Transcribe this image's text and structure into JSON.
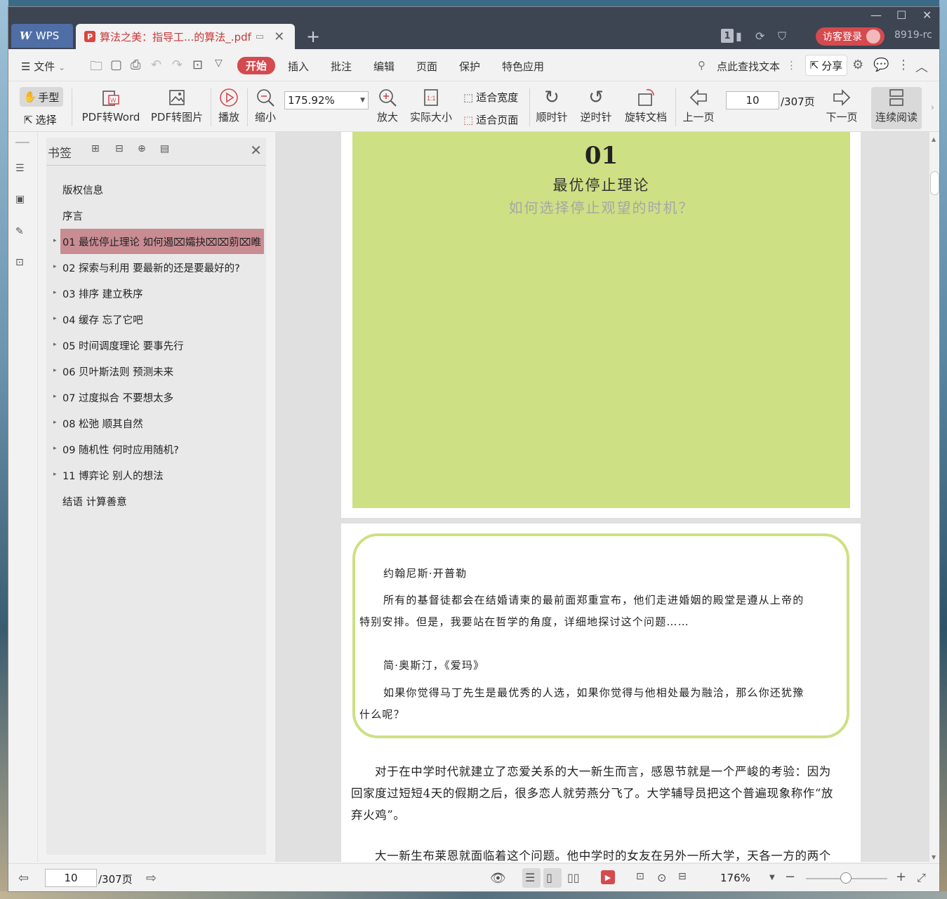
{
  "app": {
    "brand": "WPS",
    "tab_title": "算法之美：指导工...的算法_.pdf",
    "version": "8919-rc",
    "login_label": "访客登录",
    "notification_count": "1"
  },
  "menu": {
    "file_label": "文件",
    "tabs": [
      "开始",
      "插入",
      "批注",
      "编辑",
      "页面",
      "保护",
      "特色应用"
    ],
    "active_tab": "开始",
    "search_placeholder": "点此查找文本",
    "share_label": "分享"
  },
  "toolbar": {
    "hand_label": "手型",
    "select_label": "选择",
    "pdf_to_word": "PDF转Word",
    "pdf_to_image": "PDF转图片",
    "play": "播放",
    "zoom_out": "缩小",
    "zoom_value": "175.92%",
    "zoom_in": "放大",
    "actual_size": "实际大小",
    "fit_width": "适合宽度",
    "fit_page": "适合页面",
    "clockwise": "顺时针",
    "counter_clockwise": "逆时针",
    "rotate_doc": "旋转文档",
    "prev_page": "上一页",
    "page_current": "10",
    "page_total": "/307页",
    "next_page": "下一页",
    "continuous_read": "连续阅读"
  },
  "bookmarks": {
    "title": "书签",
    "items": [
      {
        "label": "版权信息",
        "expandable": false,
        "selected": false
      },
      {
        "label": "序言",
        "expandable": false,
        "selected": false
      },
      {
        "label": "01 最优停止理论 如何遏⌧孀抉⌧⌧莂⌧睢",
        "expandable": true,
        "selected": true
      },
      {
        "label": "02 探索与利用 要最新的还是要最好的?",
        "expandable": true,
        "selected": false
      },
      {
        "label": "03 排序 建立秩序",
        "expandable": true,
        "selected": false
      },
      {
        "label": "04 缓存 忘了它吧",
        "expandable": true,
        "selected": false
      },
      {
        "label": "05 时间调度理论 要事先行",
        "expandable": true,
        "selected": false
      },
      {
        "label": "06 贝叶斯法则 预测未来",
        "expandable": true,
        "selected": false
      },
      {
        "label": "07 过度拟合 不要想太多",
        "expandable": true,
        "selected": false
      },
      {
        "label": "08 松弛 顺其自然",
        "expandable": true,
        "selected": false
      },
      {
        "label": "09 随机性 何时应用随机?",
        "expandable": true,
        "selected": false
      },
      {
        "label": "11 博弈论 别人的想法",
        "expandable": true,
        "selected": false
      },
      {
        "label": "结语 计算善意",
        "expandable": false,
        "selected": false
      }
    ]
  },
  "document": {
    "chapter_number": "01",
    "chapter_title": "最优停止理论",
    "chapter_subtitle": "如何选择停止观望的时机？",
    "quote1_author": "约翰尼斯·开普勒",
    "quote1_line1": "所有的基督徒都会在结婚请柬的最前面郑重宣布，他们走进婚姻的殿堂是遵从上帝的",
    "quote1_line2": "特别安排。但是，我要站在哲学的角度，详细地探讨这个问题……",
    "quote2_author": "简·奥斯汀，《爱玛》",
    "quote2_line1": "如果你觉得马丁先生是最优秀的人选，如果你觉得与他相处最为融洽，那么你还犹豫",
    "quote2_line2": "什么呢？",
    "para1_line1": "对于在中学时代就建立了恋爱关系的大一新生而言，感恩节就是一个严峻的考验：因为",
    "para1_line2": "回家度过短短4天的假期之后，很多恋人就劳燕分飞了。大学辅导员把这个普遍现象称作“放",
    "para1_line3": "弃火鸡”。",
    "para2_line1": "大一新生布莱恩就面临着这个问题。他中学时的女友在另外一所大学，天各一方的两个"
  },
  "statusbar": {
    "page_current": "10",
    "page_total": "/307页",
    "zoom": "176%"
  },
  "colors": {
    "accent": "#d44a4e",
    "titlebar": "#3d4452",
    "chapter_green": "#cde084",
    "bookmark_selected": "#c98c93"
  }
}
